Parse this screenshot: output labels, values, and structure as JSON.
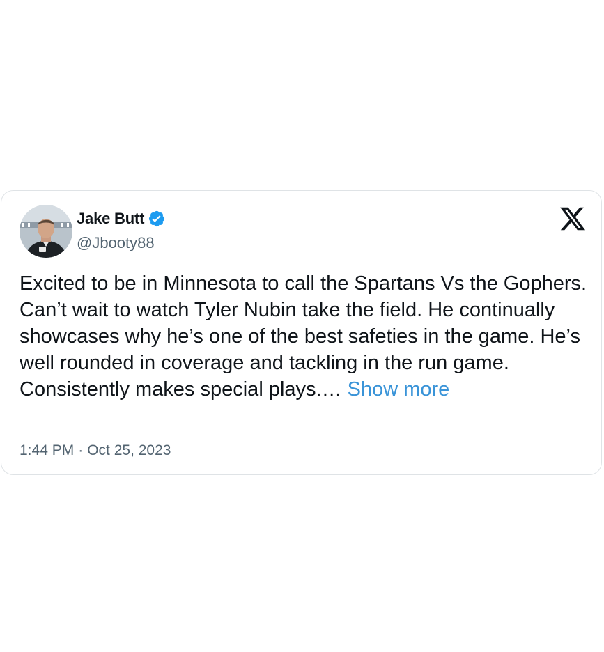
{
  "tweet": {
    "author": {
      "display_name": "Jake Butt",
      "handle": "@Jbooty88",
      "verified": true
    },
    "text": "Excited to be in Minnesota to call the Spartans Vs the Gophers. Can’t wait to watch Tyler Nubin take the field. He continually showcases why he’s one of the best safeties in the game. He’s well rounded in coverage and tackling in the run game. Consistently makes special plays.…",
    "show_more_label": "Show more",
    "time": "1:44 PM",
    "separator": "·",
    "date": "Oct 25, 2023"
  },
  "icons": {
    "platform": "x-logo-icon",
    "verified": "verified-badge-icon"
  },
  "colors": {
    "text": "#0f1419",
    "secondary": "#536471",
    "link": "#3a94d8",
    "verified": "#1d9bf0",
    "border": "#dfe3e6"
  }
}
